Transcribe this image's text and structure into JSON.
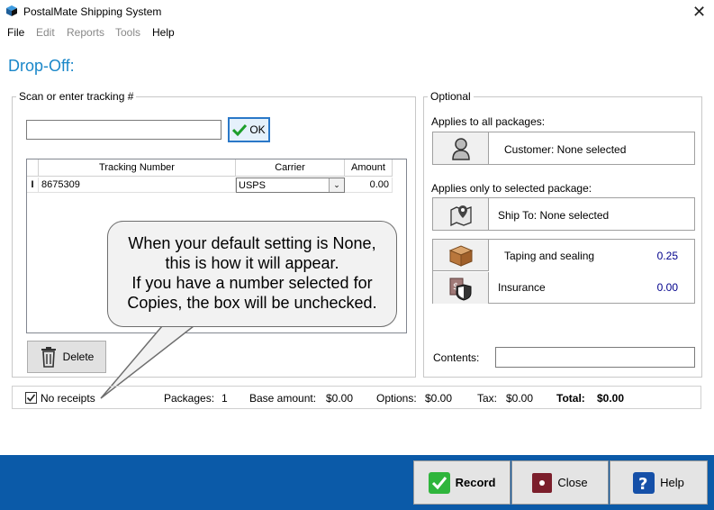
{
  "window": {
    "title": "PostalMate Shipping System",
    "close_glyph": "✕"
  },
  "menu": [
    {
      "label": "File",
      "enabled": true
    },
    {
      "label": "Edit",
      "enabled": false
    },
    {
      "label": "Reports",
      "enabled": false
    },
    {
      "label": "Tools",
      "enabled": false
    },
    {
      "label": "Help",
      "enabled": true
    }
  ],
  "page_heading": "Drop-Off:",
  "scan": {
    "group_label": "Scan or enter tracking #",
    "input_value": "",
    "ok_label": "OK",
    "grid": {
      "headers": [
        "Tracking Number",
        "Carrier",
        "Amount"
      ],
      "rows": [
        {
          "tracking": "8675309",
          "carrier": "USPS",
          "amount": "0.00"
        }
      ]
    },
    "delete_label": "Delete"
  },
  "callout": {
    "lines": [
      "When your default setting is None,",
      "this is how it will appear.",
      "If you have a number selected for",
      "Copies, the box will be unchecked."
    ]
  },
  "optional": {
    "group_label": "Optional",
    "all_packages_label": "Applies to all packages:",
    "customer": "Customer: None selected",
    "selected_package_label": "Applies only to selected package:",
    "ship_to": "Ship To: None selected",
    "taping": {
      "label": "Taping and sealing",
      "value": "0.25"
    },
    "insurance": {
      "label": "Insurance",
      "value": "0.00"
    },
    "contents_label": "Contents:",
    "contents_value": ""
  },
  "status": {
    "no_receipts_label": "No receipts",
    "no_receipts_checked": true,
    "packages_label": "Packages:",
    "packages_value": "1",
    "base_label": "Base amount:",
    "base_value": "$0.00",
    "options_label": "Options:",
    "options_value": "$0.00",
    "tax_label": "Tax:",
    "tax_value": "$0.00",
    "total_label": "Total:",
    "total_value": "$0.00"
  },
  "footer": {
    "record_label": "Record",
    "close_label": "Close",
    "help_label": "Help"
  },
  "colors": {
    "heading": "#1a87c9",
    "footer": "#0b5aa8",
    "value_blue": "#00008b",
    "check_green": "#1d9e2a"
  }
}
